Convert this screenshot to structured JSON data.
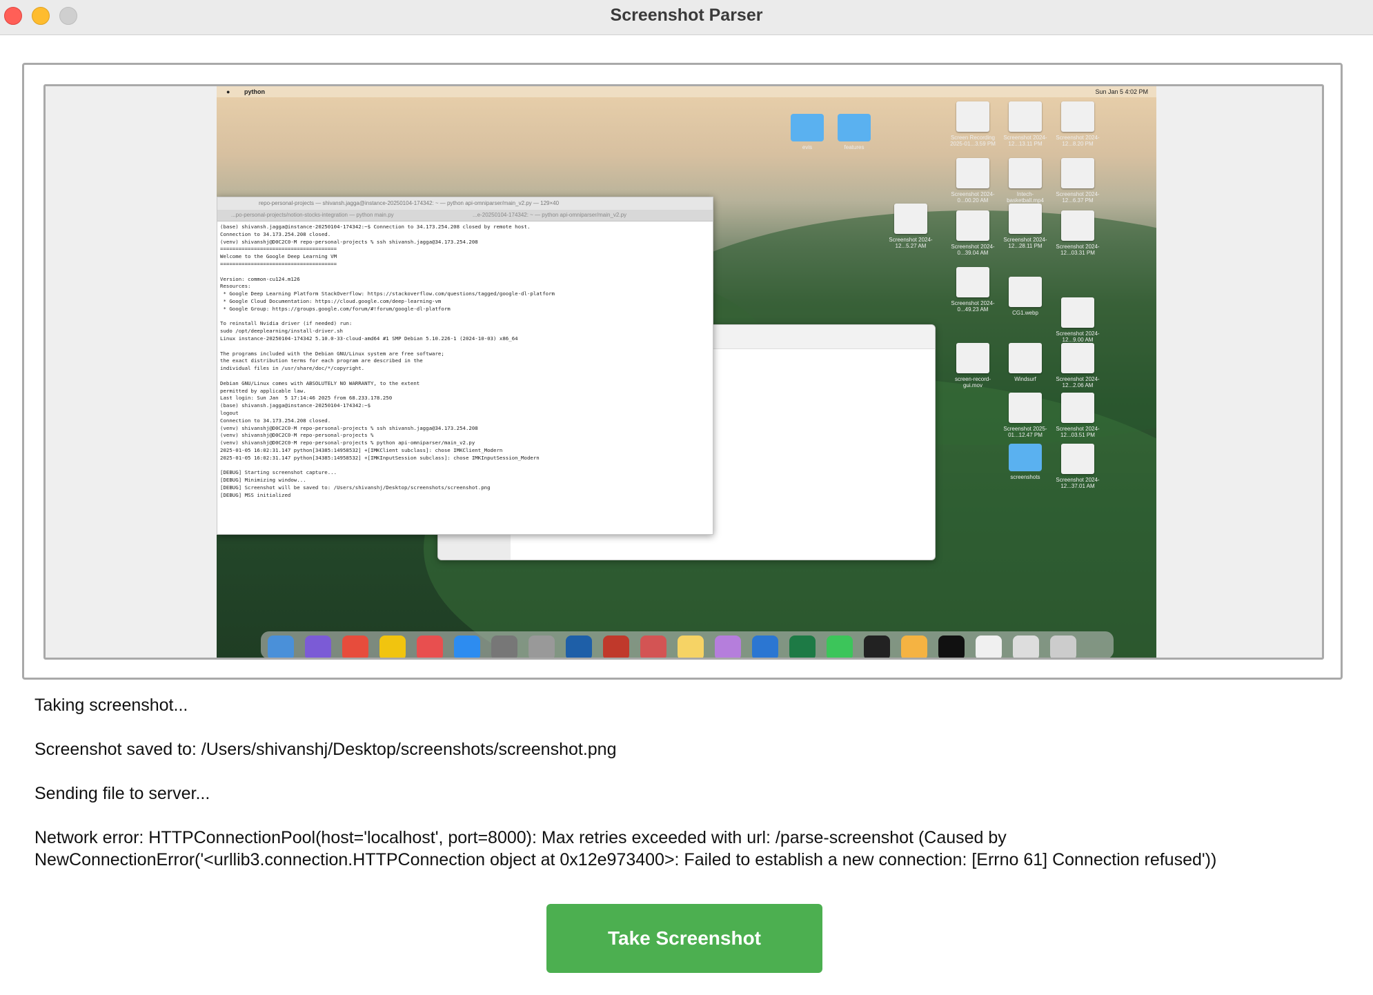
{
  "window": {
    "title": "Screenshot Parser"
  },
  "preview": {
    "menubar": {
      "app": "python",
      "clock": "Sun Jan 5 4:02 PM"
    },
    "terminal": {
      "title": "repo-personal-projects — shivansh.jagga@instance-20250104-174342: ~ — python api-omniparser/main_v2.py — 129×40",
      "tabs": [
        "...po-personal-projects/notion-stocks-integration — python main.py",
        "...e-20250104-174342: ~ — python api-omniparser/main_v2.py"
      ],
      "lines": [
        "(base) shivansh.jagga@instance-20250104-174342:~$ Connection to 34.173.254.208 closed by remote host.",
        "Connection to 34.173.254.208 closed.",
        "(venv) shivanshj@D0C2C0-M repo-personal-projects % ssh shivansh.jagga@34.173.254.208",
        "======================================",
        "Welcome to the Google Deep Learning VM",
        "======================================",
        "",
        "Version: common-cu124.m126",
        "Resources:",
        " * Google Deep Learning Platform StackOverflow: https://stackoverflow.com/questions/tagged/google-dl-platform",
        " * Google Cloud Documentation: https://cloud.google.com/deep-learning-vm",
        " * Google Group: https://groups.google.com/forum/#!forum/google-dl-platform",
        "",
        "To reinstall Nvidia driver (if needed) run:",
        "sudo /opt/deeplearning/install-driver.sh",
        "Linux instance-20250104-174342 5.10.0-33-cloud-amd64 #1 SMP Debian 5.10.226-1 (2024-10-03) x86_64",
        "",
        "The programs included with the Debian GNU/Linux system are free software;",
        "the exact distribution terms for each program are described in the",
        "individual files in /usr/share/doc/*/copyright.",
        "",
        "Debian GNU/Linux comes with ABSOLUTELY NO WARRANTY, to the extent",
        "permitted by applicable law.",
        "Last login: Sun Jan  5 17:14:46 2025 from 68.233.178.250",
        "(base) shivansh.jagga@instance-20250104-174342:~$",
        "logout",
        "Connection to 34.173.254.208 closed.",
        "(venv) shivanshj@D0C2C0-M repo-personal-projects % ssh shivansh.jagga@34.173.254.208",
        "(venv) shivanshj@D0C2C0-M repo-personal-projects %",
        "(venv) shivanshj@D0C2C0-M repo-personal-projects % python api-omniparser/main_v2.py",
        "2025-01-05 16:02:31.147 python[34385:14958532] +[IMKClient subclass]: chose IMKClient_Modern",
        "2025-01-05 16:02:31.147 python[34385:14958532] +[IMKInputSession subclass]: chose IMKInputSession_Modern",
        "",
        "[DEBUG] Starting screenshot capture...",
        "[DEBUG] Minimizing window...",
        "[DEBUG] Screenshot will be saved to: /Users/shivanshj/Desktop/screenshots/screenshot.png",
        "[DEBUG] MSS initialized"
      ]
    },
    "desktop_icons": [
      {
        "label": "evis",
        "kind": "folder"
      },
      {
        "label": "features",
        "kind": "folder"
      },
      {
        "label": "Screen Recording 2025-01...3.59 PM",
        "kind": "thumb"
      },
      {
        "label": "Screenshot 2024-12...13.11 PM",
        "kind": "thumb"
      },
      {
        "label": "Screenshot 2024-12...8.20 PM",
        "kind": "thumb"
      },
      {
        "label": "Screenshot 2024-0...00.20 AM",
        "kind": "thumb"
      },
      {
        "label": "Intech-basketball.mp4",
        "kind": "thumb"
      },
      {
        "label": "Screenshot 2024-12...6.37 PM",
        "kind": "thumb"
      },
      {
        "label": "Screenshot 2024-12...5.27 AM",
        "kind": "thumb"
      },
      {
        "label": "Screenshot 2024-0...39.04 AM",
        "kind": "thumb"
      },
      {
        "label": "Screenshot 2024-12...28.11 PM",
        "kind": "thumb"
      },
      {
        "label": "Screenshot 2024-12...03.31 PM",
        "kind": "thumb"
      },
      {
        "label": "Screenshot 2024-0...49.23 AM",
        "kind": "thumb"
      },
      {
        "label": "CG1.webp",
        "kind": "thumb"
      },
      {
        "label": "Screenshot 2024-12...9.00 AM",
        "kind": "thumb"
      },
      {
        "label": "screen-record-gui.mov",
        "kind": "thumb"
      },
      {
        "label": "Windsurf",
        "kind": "thumb"
      },
      {
        "label": "Screenshot 2024-12...2.06 AM",
        "kind": "thumb"
      },
      {
        "label": "Screenshot 2025-01...12.47 PM",
        "kind": "thumb"
      },
      {
        "label": "Screenshot 2024-12...03.51 PM",
        "kind": "thumb"
      },
      {
        "label": "screenshots",
        "kind": "folder"
      },
      {
        "label": "Screenshot 2024-12...37.01 AM",
        "kind": "thumb"
      }
    ]
  },
  "log": {
    "line1": "Taking screenshot...",
    "line2": "Screenshot saved to: /Users/shivanshj/Desktop/screenshots/screenshot.png",
    "line3": "Sending file to server...",
    "line4": "Network error: HTTPConnectionPool(host='localhost', port=8000): Max retries exceeded with url: /parse-screenshot (Caused by",
    "line5": "NewConnectionError('<urllib3.connection.HTTPConnection object at 0x12e973400>: Failed to establish a new connection: [Errno 61] Connection refused'))"
  },
  "buttons": {
    "take_screenshot": "Take Screenshot"
  },
  "colors": {
    "button": "#4caf50",
    "close": "#ff5f57",
    "minimize": "#febc2e",
    "zoom_disabled": "#cfcfcf"
  }
}
